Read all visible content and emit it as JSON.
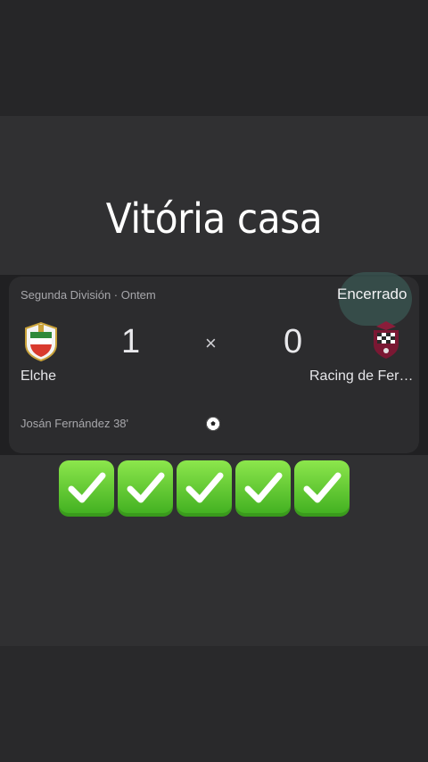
{
  "headline": "Vitória casa",
  "match": {
    "league_line": "Segunda División · Ontem",
    "status": "Encerrado",
    "home_team": "Elche",
    "away_team": "Racing de Fer…",
    "home_score": "1",
    "away_score": "0",
    "separator": "×",
    "scorer": "Josán Fernández 38'"
  },
  "icons": {
    "home_crest": "elche-crest-icon",
    "away_crest": "racing-ferrol-crest-icon",
    "goal": "soccer-ball-icon",
    "check": "check-mark-button-icon"
  },
  "check_count": 5,
  "colors": {
    "background": "#303032",
    "card": "#2c2c2e",
    "check_green": "#5ec432"
  }
}
